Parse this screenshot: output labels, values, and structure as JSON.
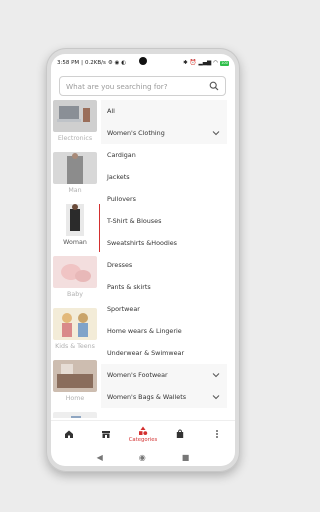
{
  "status": {
    "time": "3:58 PM",
    "speed": "0.2KB/s",
    "battery": "100"
  },
  "search": {
    "placeholder": "What are you searching for?"
  },
  "left_categories": [
    {
      "label": "Electronics",
      "active": false
    },
    {
      "label": "Man",
      "active": false
    },
    {
      "label": "Woman",
      "active": true
    },
    {
      "label": "Baby",
      "active": false
    },
    {
      "label": "Kids & Teens",
      "active": false
    },
    {
      "label": "Home",
      "active": false
    }
  ],
  "subcategories": [
    {
      "label": "All",
      "expand": false
    },
    {
      "label": "Women's Clothing",
      "expand": true
    },
    {
      "label": "Cardigan",
      "expand": false
    },
    {
      "label": "Jackets",
      "expand": false
    },
    {
      "label": "Pullovers",
      "expand": false
    },
    {
      "label": "T-Shirt & Blouses",
      "expand": false
    },
    {
      "label": "Sweatshirts &Hoodies",
      "expand": false
    },
    {
      "label": "Dresses",
      "expand": false
    },
    {
      "label": "Pants & skirts",
      "expand": false
    },
    {
      "label": "Sportwear",
      "expand": false
    },
    {
      "label": "Home wears & Lingerie",
      "expand": false
    },
    {
      "label": "Underwear & Swimwear",
      "expand": false
    },
    {
      "label": "Women's Footwear",
      "expand": true
    },
    {
      "label": "Women's Bags & Wallets",
      "expand": true
    }
  ],
  "bottom_nav": {
    "active_label": "Categories"
  },
  "colors": {
    "accent": "#d32f2f"
  }
}
